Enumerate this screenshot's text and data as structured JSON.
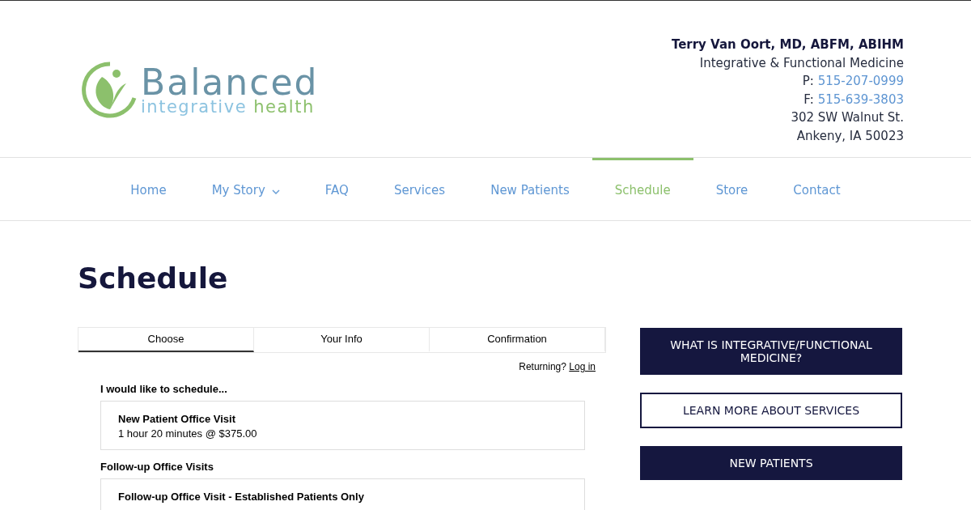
{
  "logo": {
    "word": "Balanced",
    "tagline_start": "integrative",
    "tagline_end": "health"
  },
  "contact": {
    "name": "Terry Van Oort, MD, ABFM, ABIHM",
    "specialty": "Integrative & Functional Medicine",
    "phone_label": "P:",
    "phone": "515-207-0999",
    "fax_label": "F:",
    "fax": "515-639-3803",
    "street": "302 SW Walnut St.",
    "city": "Ankeny, IA 50023"
  },
  "nav": [
    {
      "label": "Home",
      "selected": false,
      "has_dropdown": false
    },
    {
      "label": "My Story",
      "selected": false,
      "has_dropdown": true
    },
    {
      "label": "FAQ",
      "selected": false,
      "has_dropdown": false
    },
    {
      "label": "Services",
      "selected": false,
      "has_dropdown": false
    },
    {
      "label": "New Patients",
      "selected": false,
      "has_dropdown": false
    },
    {
      "label": "Schedule",
      "selected": true,
      "has_dropdown": false
    },
    {
      "label": "Store",
      "selected": false,
      "has_dropdown": false
    },
    {
      "label": "Contact",
      "selected": false,
      "has_dropdown": false
    }
  ],
  "page_title": "Schedule",
  "steps": [
    {
      "label": "Choose",
      "selected": true
    },
    {
      "label": "Your Info",
      "selected": false
    },
    {
      "label": "Confirmation",
      "selected": false
    }
  ],
  "returning": {
    "text": "Returning?",
    "link": "Log in"
  },
  "sections": [
    {
      "heading": "I would like to schedule...",
      "items": [
        {
          "title": "New Patient Office Visit",
          "detail": "1 hour 20 minutes @ $375.00"
        }
      ]
    },
    {
      "heading": "Follow-up Office Visits",
      "items": [
        {
          "title": "Follow-up Office Visit - Established Patients Only"
        }
      ]
    }
  ],
  "sidebar_buttons": [
    {
      "label": "WHAT IS INTEGRATIVE/FUNCTIONAL MEDICINE?",
      "kind": "filled"
    },
    {
      "label": "LEARN MORE ABOUT SERVICES",
      "kind": "outline"
    },
    {
      "label": "NEW PATIENTS",
      "kind": "filled"
    }
  ]
}
